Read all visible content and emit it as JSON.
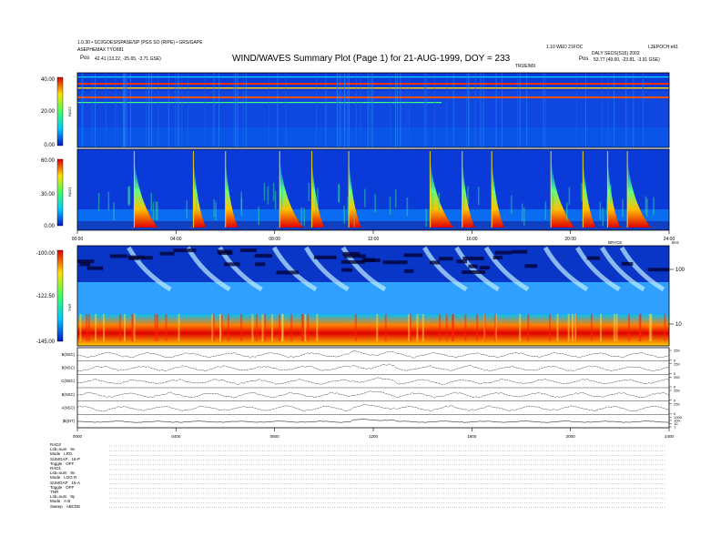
{
  "header": {
    "title": "WIND/WAVES Summary Plot (Page 1) for 21-AUG-1999, DOY = 233",
    "left_line1": "1.0.30 • SCI/GOES/SPASE/SP (PGS SO (RIPE) • GRS/GAPE",
    "left_line2": "ASEPHEMAX TYO681",
    "left_pos_label": "Pos",
    "left_pos_value": "42.41 (13.22, -25.65, -3.71 GSE)",
    "right_line1": "1.10 WED 21FOC",
    "right_line1b": "L3EPOCH:e61",
    "right_line2": "DALY  SEOS(S15) 2002",
    "right_pos_label": "Pos",
    "right_pos_value": "53.77 (49.60, -23.81, -3.91 GSE)",
    "upper_axis_label": "TRUE/MX"
  },
  "colors": {
    "axis": "#000000",
    "background": "#ffffff"
  },
  "chart_data": [
    {
      "type": "heatmap",
      "panel": "RAD2",
      "colorbar_ticks": [
        "40.00",
        "20.00",
        "0.00"
      ],
      "colorbar_range": [
        0,
        40
      ]
    },
    {
      "type": "heatmap",
      "panel": "RAD1",
      "colorbar_ticks": [
        "60.00",
        "30.00",
        "0.00"
      ],
      "colorbar_range": [
        0,
        60
      ],
      "x_ticks": [
        "00:00",
        "04:00",
        "08:00",
        "12:00",
        "16:00",
        "20:00",
        "24:00"
      ],
      "x_range": [
        0,
        24
      ],
      "burst_times_hours": [
        2.3,
        4.7,
        6.0,
        8.2,
        9.5,
        11.0,
        14.3,
        15.6,
        16.8,
        19.2,
        20.5,
        21.5,
        22.3
      ]
    },
    {
      "type": "heatmap",
      "panel": "TNR",
      "colorbar_ticks": [
        "-100.00",
        "-122.50",
        "-145.00"
      ],
      "colorbar_range": [
        -145,
        -100
      ],
      "right_ticks": [
        "100",
        "10"
      ],
      "right_label": "kHz",
      "top_right_label": "BRYCE",
      "x_range": [
        0,
        24
      ]
    },
    {
      "type": "line",
      "panel": "magnetic field",
      "series": [
        {
          "name": "B(NSC)",
          "right_ticks": [
            "250",
            "0"
          ]
        },
        {
          "name": "B(NSC)",
          "right_ticks": [
            "250",
            "0"
          ]
        },
        {
          "name": "C(NSC)",
          "right_ticks": [
            "250",
            "0"
          ]
        },
        {
          "name": "B(NSC)",
          "right_ticks": [
            "250",
            "0"
          ]
        },
        {
          "name": "A(NSC)",
          "right_ticks": [
            "250",
            "0"
          ]
        },
        {
          "name": "|B|(NT)",
          "right_ticks": [
            "1000",
            "100",
            "10",
            "1"
          ]
        }
      ],
      "x_ticks": [
        "0000",
        "0400",
        "0800",
        "1200",
        "1600",
        "2000",
        "2400"
      ],
      "x_range": [
        0,
        24
      ]
    }
  ],
  "footer": {
    "rows": [
      {
        "label": "RAD2",
        "value": ""
      },
      {
        "label": "Lsb=sum",
        "value": "9v"
      },
      {
        "label": "Mode",
        "value": "LRG"
      },
      {
        "label": "SUMGAP",
        "value": "16-P"
      },
      {
        "label": "Toggle",
        "value": "OFF"
      },
      {
        "label": "RAD1",
        "value": ""
      },
      {
        "label": "Lsb=sum",
        "value": "9v"
      },
      {
        "label": "Mode",
        "value": "LOG R"
      },
      {
        "label": "SUMGAP",
        "value": "16-A"
      },
      {
        "label": "Toggle",
        "value": "OFF"
      },
      {
        "label": "TNR",
        "value": ""
      },
      {
        "label": "Lsb=sum",
        "value": "9y"
      },
      {
        "label": "Mode",
        "value": "A B"
      },
      {
        "label": "Sweep",
        "value": "ABCDE"
      }
    ]
  }
}
